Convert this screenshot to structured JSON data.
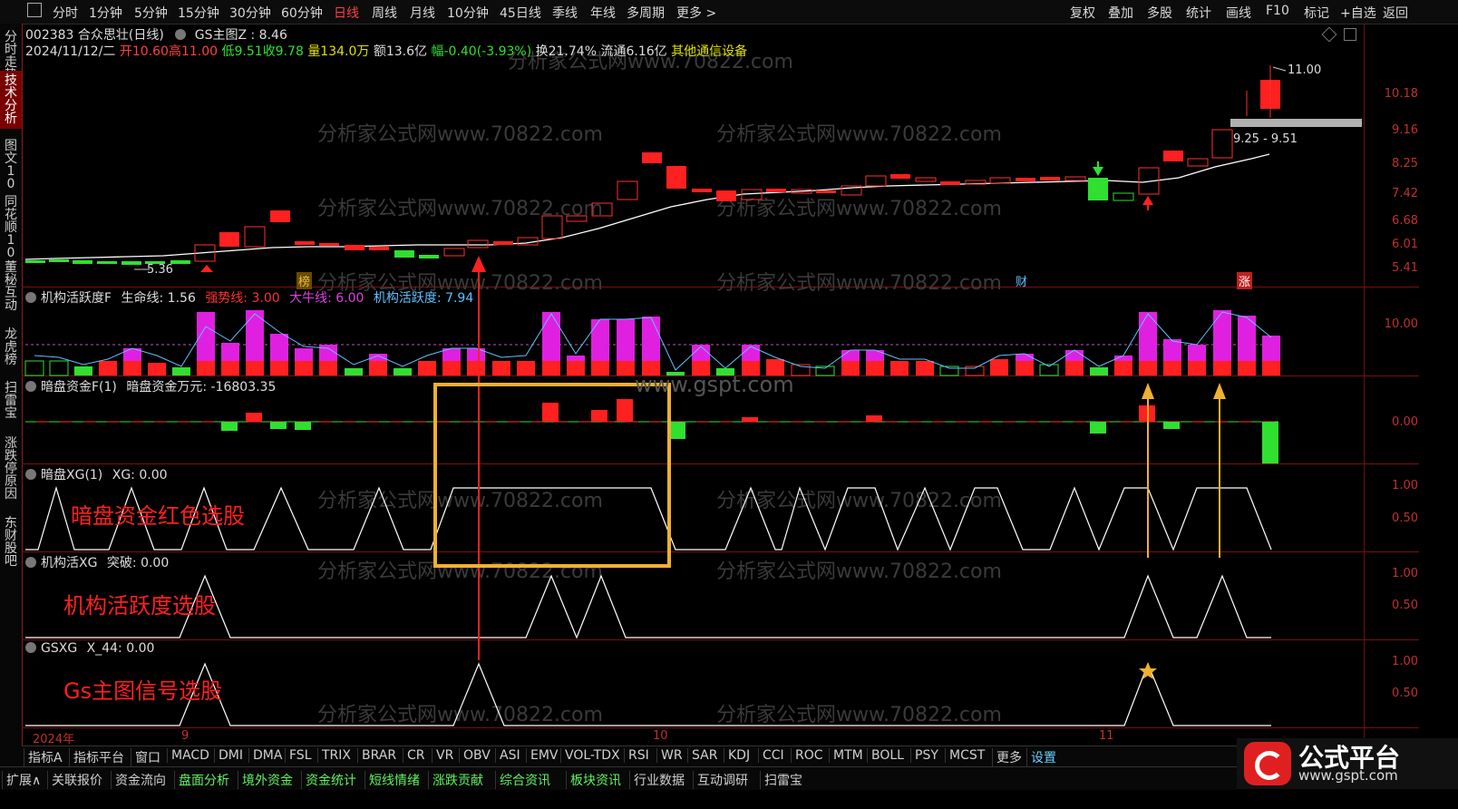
{
  "topbar": {
    "left_items": [
      "分时",
      "1分钟",
      "5分钟",
      "15分钟",
      "30分钟",
      "60分钟",
      "日线",
      "周线",
      "月线",
      "10分钟",
      "45日线",
      "季线",
      "年线",
      "多周期",
      "更多 >"
    ],
    "active": "日线",
    "right_items": [
      "复权",
      "叠加",
      "多股",
      "统计",
      "画线",
      "F10",
      "标记",
      "+自选",
      "返回"
    ]
  },
  "sidebar": [
    "分时走势",
    "技术分析",
    "图文10",
    "同花顺10",
    "董秘互动",
    "龙虎榜",
    "扫雷宝",
    "涨跌停原因",
    "东财股吧"
  ],
  "sidebar_active": "技术分析",
  "stock": {
    "header": "002383 合众思壮(日线)",
    "indicator": "GS主图Z : 8.46",
    "date": "2024/11/12/二",
    "open": "开10.60",
    "high": "高11.00",
    "low": "低9.51",
    "close": "收9.78",
    "volume": "量134.0万",
    "amount": "额13.6亿",
    "change": "幅-0.40(-3.93%)",
    "turnover": "换21.74%",
    "float": "流通6.16亿",
    "sector": "其他通信设备"
  },
  "main_axis": [
    "10.18",
    "9.16",
    "8.25",
    "7.42",
    "6.68",
    "6.01",
    "5.41"
  ],
  "main_labels": {
    "high": "11.00",
    "low": "5.36",
    "range": "9.25 - 9.51",
    "tag1": "榜",
    "tag2": "财",
    "tag3": "涨"
  },
  "panel1": {
    "name": "机构活跃度F",
    "l1": "生命线: 1.56",
    "l2": "强势线: 3.00",
    "l3": "大牛线: 6.00",
    "l4": "机构活跃度: 7.94",
    "axis": [
      "10.00"
    ]
  },
  "panel2": {
    "name": "暗盘资金F(1)",
    "l1": "暗盘资金万元: -16803.35",
    "axis": [
      "0.00"
    ],
    "watermark": "www.gspt.com"
  },
  "panel3": {
    "name": "暗盘XG(1)",
    "l1": "XG: 0.00",
    "axis": [
      "1.00",
      "0.50"
    ],
    "annotation": "暗盘资金红色选股"
  },
  "panel4": {
    "name": "机构活XG",
    "l1": "突破: 0.00",
    "axis": [
      "1.00",
      "0.50"
    ],
    "annotation": "机构活跃度选股"
  },
  "panel5": {
    "name": "GSXG",
    "l1": "X_44: 0.00",
    "axis": [
      "1.00",
      "0.50"
    ],
    "annotation": "Gs主图信号选股"
  },
  "xaxis": {
    "year": "2024年",
    "m1": "9",
    "m2": "10",
    "m3": "11"
  },
  "watermark": "分析家公式网www.70822.com",
  "bottom_tabs": [
    "指标A",
    "指标平台",
    "窗口",
    "MACD",
    "DMI",
    "DMA",
    "FSL",
    "TRIX",
    "BRAR",
    "CR",
    "VR",
    "OBV",
    "ASI",
    "EMV",
    "VOL-TDX",
    "RSI",
    "WR",
    "SAR",
    "KDJ",
    "CCI",
    "ROC",
    "MTM",
    "BOLL",
    "PSY",
    "MCST",
    "更多",
    "设置"
  ],
  "bottom_tabs2": [
    "扩展∧",
    "关联报价",
    "资金流向",
    "盘面分析",
    "境外资金",
    "资金统计",
    "短线情绪",
    "涨跌贡献",
    "综合资讯",
    "板块资讯",
    "行业数据",
    "互动调研",
    "扫雷宝"
  ],
  "logo": {
    "text": "公式平台",
    "url": "www.gspt.com"
  }
}
